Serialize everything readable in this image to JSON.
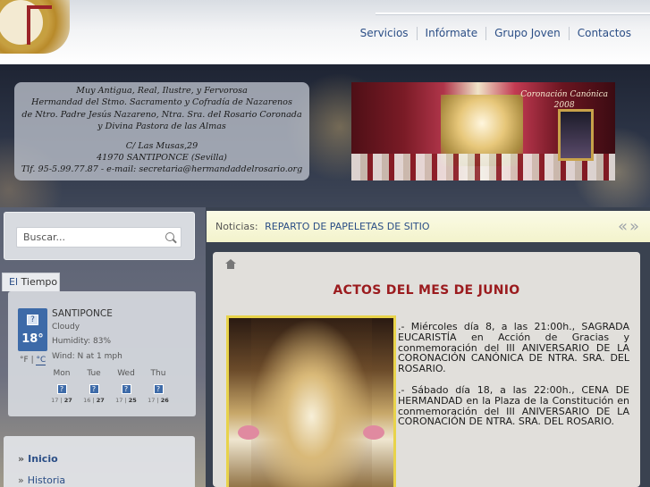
{
  "nav": {
    "items": [
      "Servicios",
      "Infórmate",
      "Grupo Joven",
      "Contactos"
    ]
  },
  "header": {
    "info_lines": [
      "Muy Antigua, Real, Ilustre, y Fervorosa",
      "Hermandad del Stmo. Sacramento y Cofradía de Nazarenos",
      "de Ntro. Padre Jesús Nazareno, Ntra. Sra. del Rosario Coronada",
      "y Divina Pastora de las Almas"
    ],
    "address_lines": [
      "C/ Las Musas,29",
      "41970 SANTIPONCE (Sevilla)",
      "Tlf. 95-5.99.77.87 - e-mail: secretaria@hermandaddelrosario.org"
    ],
    "photo_title": "Coronación Canónica",
    "photo_year": "2008"
  },
  "search": {
    "placeholder": "Buscar..."
  },
  "weather": {
    "tab_prefix": "El",
    "tab_label": "Tiempo",
    "icon_glyph": "?",
    "temp": "18°",
    "city": "SANTIPONCE",
    "condition": "Cloudy",
    "humidity": "Humidity: 83%",
    "wind": "Wind: N at 1 mph",
    "unit_f": "°F",
    "unit_sep": "|",
    "unit_c": "°C",
    "forecast": [
      {
        "day": "Mon",
        "low": "17",
        "high": "27"
      },
      {
        "day": "Tue",
        "low": "16",
        "high": "27"
      },
      {
        "day": "Wed",
        "low": "17",
        "high": "25"
      },
      {
        "day": "Thu",
        "low": "17",
        "high": "26"
      }
    ]
  },
  "menu": {
    "items": [
      "Inicio",
      "Historia"
    ],
    "marker": "»"
  },
  "news": {
    "label": "Noticias:",
    "headline": "REPARTO DE PAPELETAS DE SITIO",
    "arrows": "«»"
  },
  "article": {
    "title": "ACTOS DEL MES DE JUNIO",
    "paragraphs": [
      ".- Miércoles día 8, a las 21:00h., SAGRADA EUCARISTÍA en Acción de Gracias y conmemoración del III ANIVERSARIO DE LA CORONACIÓN CANÓNICA DE NTRA. SRA. DEL ROSARIO.",
      ".- Sábado día 18, a las 22:00h., CENA DE HERMANDAD en la Plaza de la Constitución en conmemoración del III ANIVERSARIO DE LA CORONACIÓN DE NTRA. SRA. DEL ROSARIO."
    ]
  }
}
